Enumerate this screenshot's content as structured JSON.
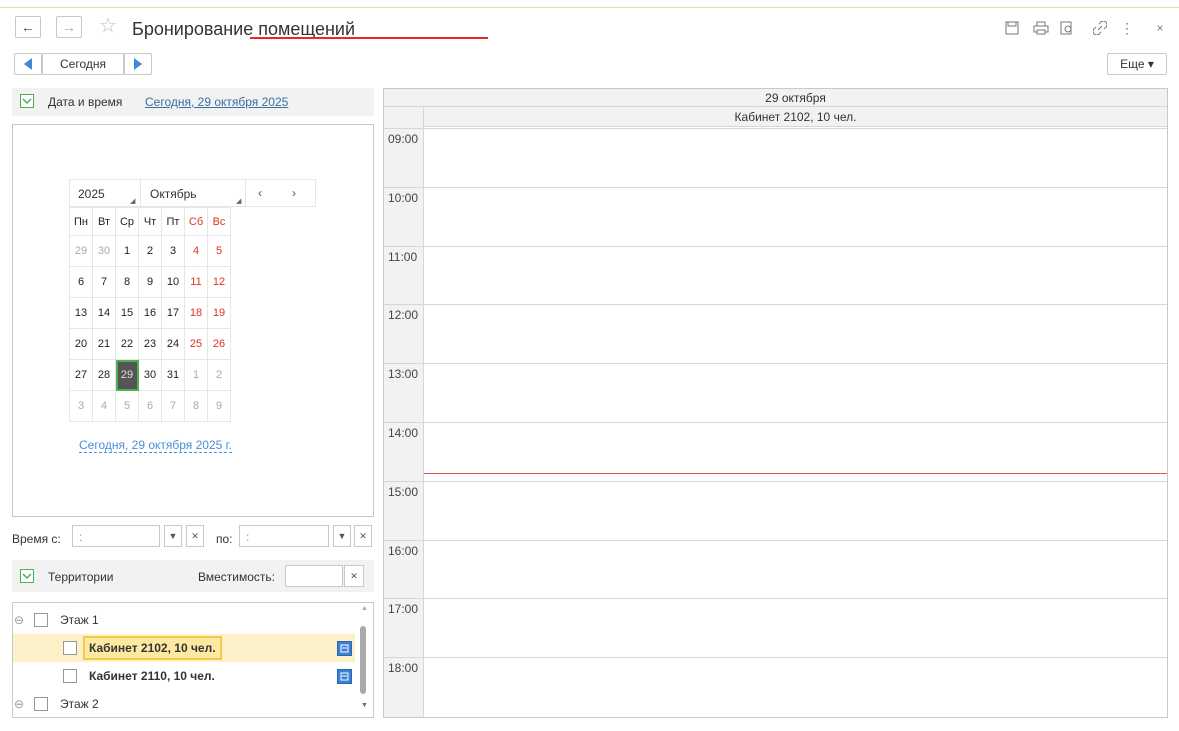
{
  "window": {
    "title": "Бронирование помещений",
    "accent_color": "#e8262b"
  },
  "nav": {
    "back_icon": "arrow-left-icon",
    "forward_icon": "arrow-right-icon",
    "favorite_icon": "star-icon"
  },
  "toolbar": {
    "prev_icon": "arrow-left-icon",
    "today_label": "Сегодня",
    "next_icon": "arrow-right-icon",
    "more_label": "Еще ▾"
  },
  "date_group": {
    "label": "Дата и время",
    "today_link": "Сегодня, 29 октября 2025"
  },
  "calendar": {
    "year": "2025",
    "month": "Октябрь",
    "weekdays": [
      "Пн",
      "Вт",
      "Ср",
      "Чт",
      "Пт",
      "Сб",
      "Вс"
    ],
    "weeks": [
      [
        "29",
        "30",
        "1",
        "2",
        "3",
        "4",
        "5"
      ],
      [
        "6",
        "7",
        "8",
        "9",
        "10",
        "11",
        "12"
      ],
      [
        "13",
        "14",
        "15",
        "16",
        "17",
        "18",
        "19"
      ],
      [
        "20",
        "21",
        "22",
        "23",
        "24",
        "25",
        "26"
      ],
      [
        "27",
        "28",
        "29",
        "30",
        "31",
        "1",
        "2"
      ],
      [
        "3",
        "4",
        "5",
        "6",
        "7",
        "8",
        "9"
      ]
    ],
    "selected": "29",
    "today_link": "Сегодня, 29 октября 2025 г.",
    "weekend_color": "#e0341e"
  },
  "time_filter": {
    "from_label": "Время с:",
    "to_label": "по:",
    "from_value": " :",
    "to_value": " :"
  },
  "territories": {
    "label": "Территории",
    "capacity_label": "Вместимость:",
    "capacity_value": "",
    "items": [
      {
        "label": "Этаж 1"
      },
      {
        "label": "Кабинет 2102, 10 чел."
      },
      {
        "label": "Кабинет 2110, 10 чел."
      },
      {
        "label": "Этаж 2"
      }
    ]
  },
  "schedule": {
    "date_header": "29 октября",
    "room_header": "Кабинет 2102, 10 чел.",
    "hours": [
      "09:00",
      "10:00",
      "11:00",
      "12:00",
      "13:00",
      "14:00",
      "15:00",
      "16:00",
      "17:00",
      "18:00"
    ],
    "current_time_color": "#d9534f"
  }
}
